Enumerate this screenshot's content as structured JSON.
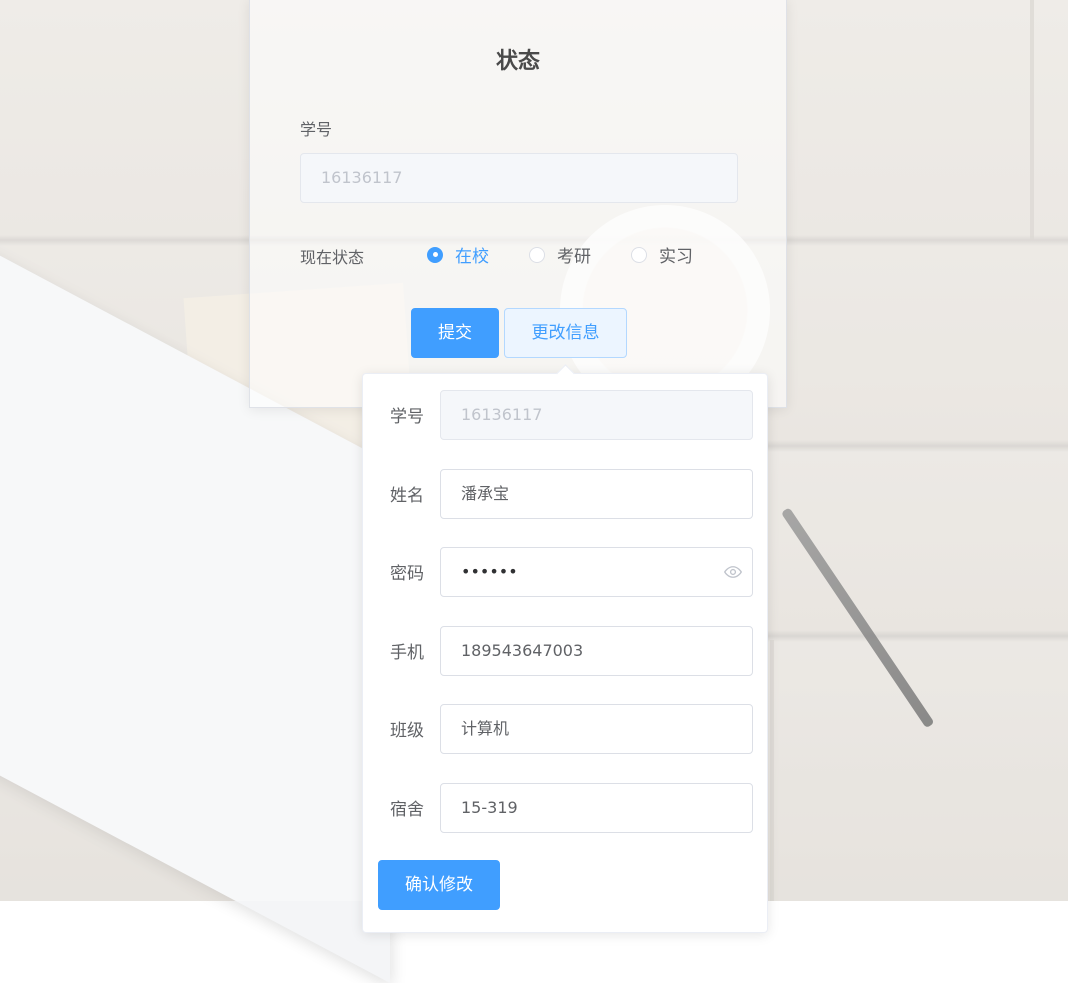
{
  "status_card": {
    "title": "状态",
    "student_id_label": "学号",
    "student_id_value": "16136117",
    "status_label": "现在状态",
    "status_options": [
      {
        "label": "在校",
        "checked": true
      },
      {
        "label": "考研",
        "checked": false
      },
      {
        "label": "实习",
        "checked": false
      }
    ],
    "submit_label": "提交",
    "edit_label": "更改信息"
  },
  "edit_form": {
    "fields": [
      {
        "label": "学号",
        "value": "16136117",
        "disabled": true
      },
      {
        "label": "姓名",
        "value": "潘承宝"
      },
      {
        "label": "密码",
        "value": "••••••",
        "icon": "eye-icon"
      },
      {
        "label": "手机",
        "value": "189543647003"
      },
      {
        "label": "班级",
        "value": "计算机"
      },
      {
        "label": "宿舍",
        "value": "15-319"
      }
    ],
    "confirm_label": "确认修改"
  },
  "colors": {
    "primary": "#409eff",
    "plain_bg": "#ecf5ff",
    "border": "#dcdfe6"
  }
}
